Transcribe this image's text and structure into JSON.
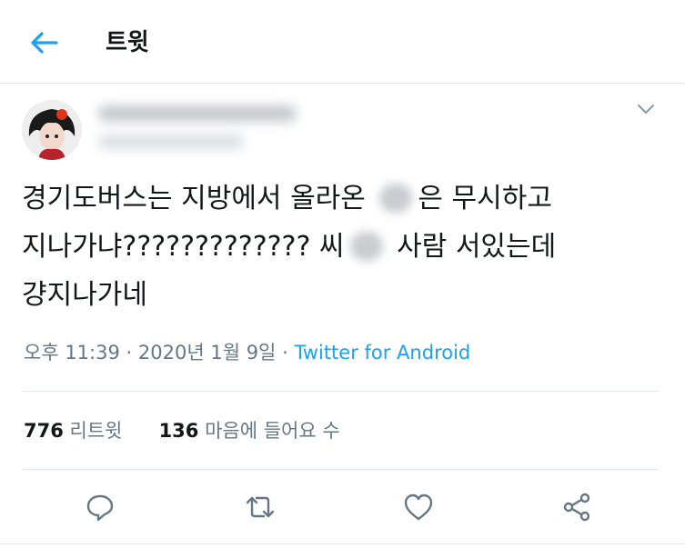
{
  "header": {
    "title": "트윗",
    "back_icon": "back-arrow-icon",
    "accent": "#1da1f2"
  },
  "tweet": {
    "text_lines": [
      [
        "경기도버스는 지방에서 올라온 ",
        "은 무시하고"
      ],
      [
        "지나가냐????????????? 씨",
        " 사람 서있는데"
      ],
      [
        "걍지나가네"
      ]
    ],
    "time": "오후 11:39",
    "sep": "·",
    "date": "2020년 1월 9일",
    "source": "Twitter for Android"
  },
  "stats": {
    "retweets_count": "776",
    "retweets_label": "리트윗",
    "likes_count": "136",
    "likes_label": "마음에 들어요 수"
  },
  "actions": [
    "reply-icon",
    "retweet-icon",
    "like-icon",
    "share-icon"
  ]
}
